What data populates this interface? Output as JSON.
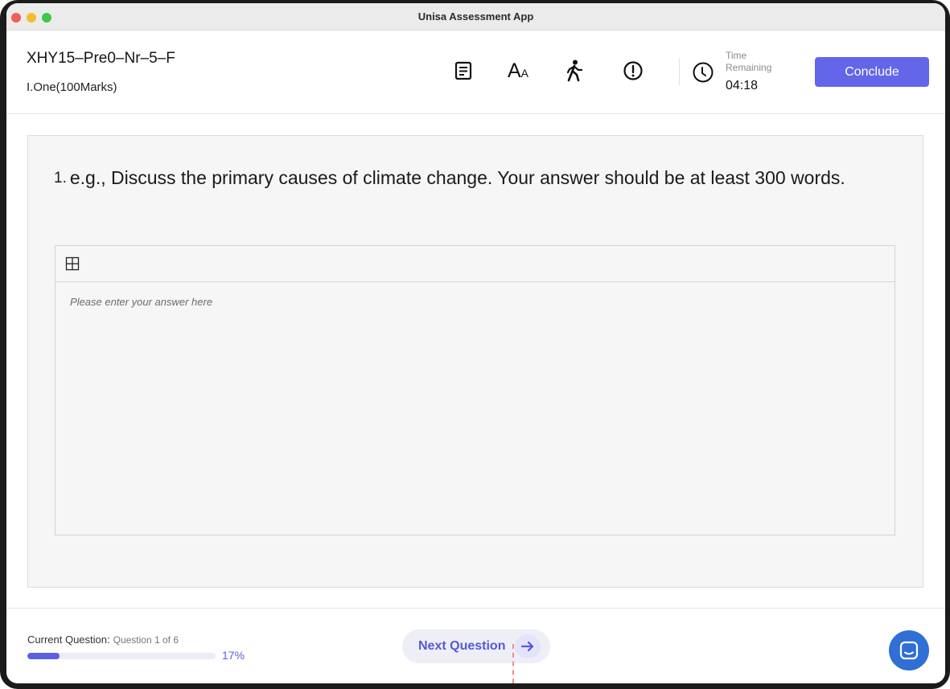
{
  "window": {
    "title": "Unisa Assessment App"
  },
  "header": {
    "exam_code": "XHY15–Pre0–Nr–5–F",
    "section": "I.One(100Marks)",
    "tools": [
      {
        "name": "notes-icon"
      },
      {
        "name": "font-size-icon",
        "glyph": "A",
        "glyph_small": "A"
      },
      {
        "name": "accessibility-walk-icon"
      },
      {
        "name": "alert-icon"
      }
    ],
    "timer": {
      "label": "Time Remaining",
      "value": "04:18",
      "icon": "clock-icon"
    },
    "conclude_label": "Conclude"
  },
  "question": {
    "number": "1.",
    "text": "e.g., Discuss the primary causes of climate change. Your answer should be at least 300 words.",
    "editor": {
      "toolbar_icon": "table-grid-icon",
      "placeholder": "Please enter your answer here",
      "value": ""
    }
  },
  "footer": {
    "current_label": "Current Question:",
    "current_value": "Question 1 of 6",
    "progress_percent": 17,
    "progress_text": "17%",
    "next_label": "Next Question",
    "next_icon": "arrow-right-icon",
    "chat_icon": "chat-bubble-icon"
  },
  "colors": {
    "accent": "#6366e8",
    "progress": "#5b5ee6",
    "chat": "#2f6fd6",
    "dashed_guide": "#f28a8a"
  }
}
